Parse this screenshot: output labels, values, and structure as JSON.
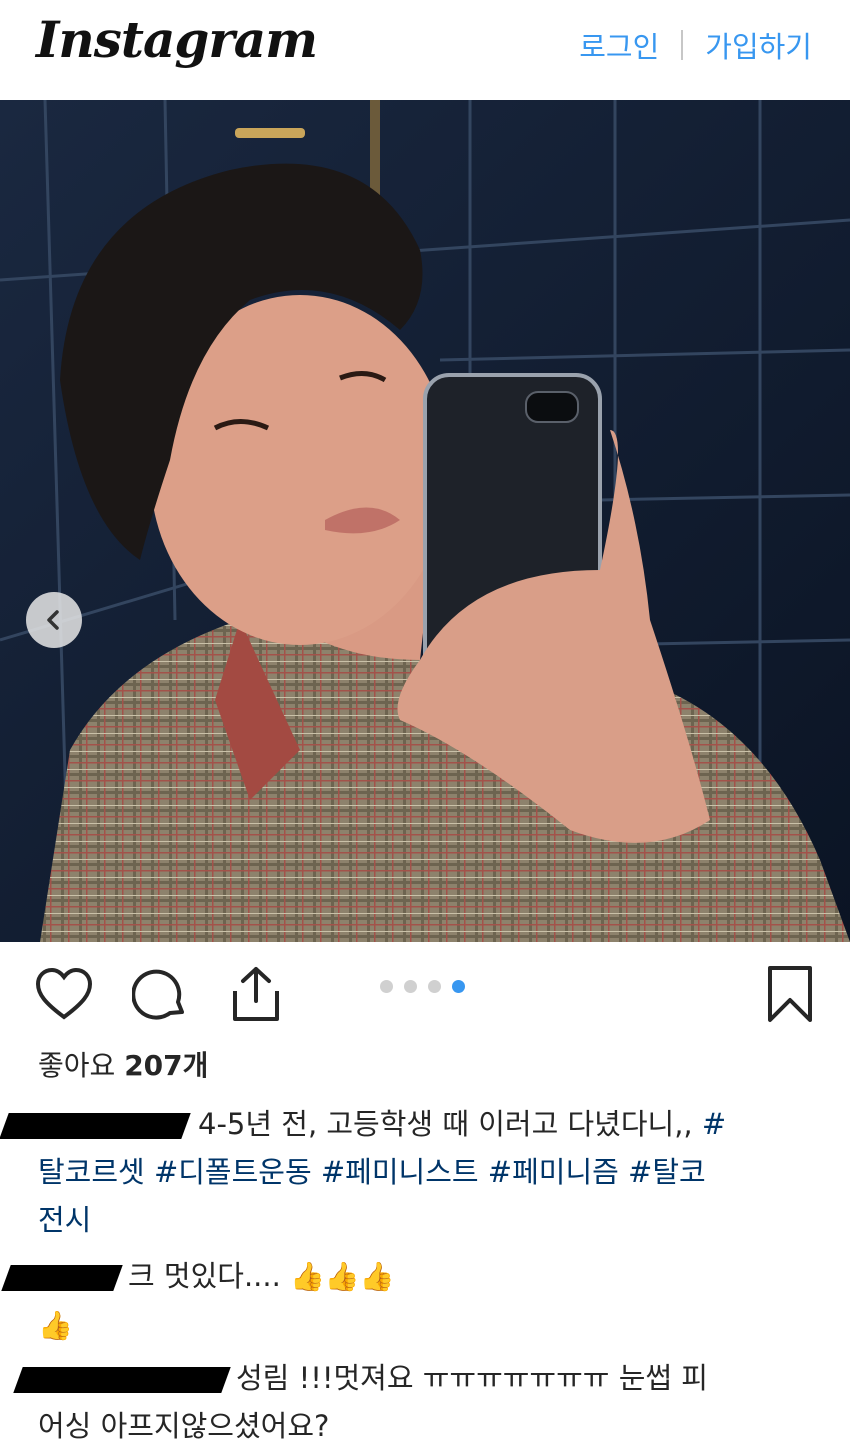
{
  "header": {
    "logo": "Instagram",
    "login_label": "로그인",
    "signup_label": "가입하기"
  },
  "carousel": {
    "total": 4,
    "active_index": 3
  },
  "post": {
    "likes_prefix": "좋아요",
    "likes_count": "207개",
    "caption_text": "4-5년 전, 고등학생 때 이러고 다녔다니,,",
    "hashtags": [
      "#",
      "탈코르셋",
      "#디폴트운동",
      "#페미니스트",
      "#페미니즘",
      "#탈코",
      "전시"
    ]
  },
  "comments": [
    {
      "text": "크 멋있다....",
      "emoji": [
        "👍",
        "👍",
        "👍",
        "👍"
      ]
    },
    {
      "text_line1": "성림 !!!멋져요 ㅠㅠㅠㅠㅠㅠㅠ 눈썹 피",
      "text_line2": "어싱 아프지않으셨어요?"
    }
  ],
  "colors": {
    "link": "#3897f0",
    "hashtag": "#003569",
    "text": "#262626",
    "dot_active": "#3897f0",
    "dot_inactive": "#d0d0d0"
  },
  "icons": [
    "heart-icon",
    "comment-icon",
    "share-icon",
    "bookmark-icon",
    "chevron-left-icon"
  ]
}
